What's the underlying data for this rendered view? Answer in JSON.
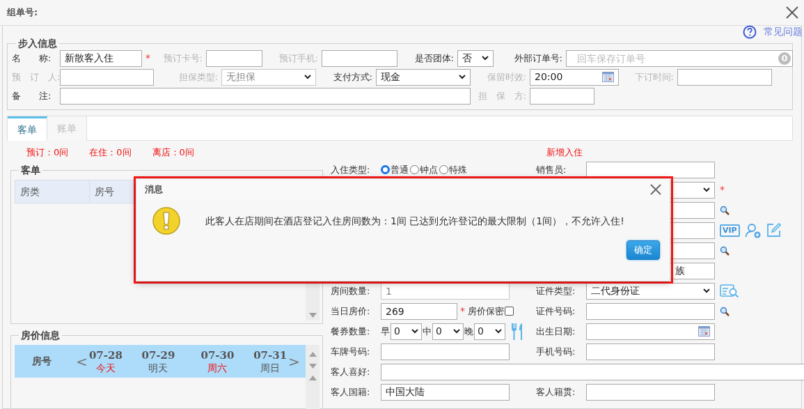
{
  "header": {
    "title": "组单号:"
  },
  "help_link": {
    "label": "常见问题"
  },
  "required_mark": "*",
  "booking": {
    "legend": "步入信息",
    "lines": [
      {
        "fields": [
          {
            "label": "名　　称:",
            "kind": "text",
            "value": "新散客入住",
            "required": true,
            "muted": false,
            "disabled": false
          },
          {
            "label": "预订卡号:",
            "kind": "text",
            "required": false,
            "muted": true,
            "disabled": false
          },
          {
            "label": "预订手机:",
            "kind": "text",
            "required": false,
            "muted": true,
            "disabled": false
          },
          {
            "label": "是否团体:",
            "kind": "select",
            "value": "否",
            "required": false,
            "muted": false,
            "disabled": false
          },
          {
            "label": "外部订单号:",
            "kind": "text",
            "placeholder": "回车保存订单号",
            "badge": "0",
            "required": false,
            "muted": false,
            "disabled": false
          }
        ]
      },
      {
        "fields": [
          {
            "label": "预　订　人:",
            "kind": "text",
            "required": false,
            "muted": true,
            "disabled": false
          },
          {
            "label": "担保类型:",
            "kind": "select",
            "value": "无担保",
            "required": false,
            "muted": true,
            "disabled": true
          },
          {
            "label": "支付方式:",
            "kind": "select",
            "value": "现金",
            "required": false,
            "muted": false,
            "disabled": false
          },
          {
            "label": "保留时效:",
            "kind": "date",
            "value": "20:00",
            "required": false,
            "muted": true,
            "disabled": false
          },
          {
            "label": "下订时间:",
            "kind": "text",
            "required": false,
            "muted": true,
            "disabled": false
          }
        ]
      },
      {
        "fields": [
          {
            "label": "备　　注:",
            "kind": "text",
            "required": false,
            "muted": false,
            "disabled": false
          },
          {
            "label": "担　保　方:",
            "kind": "text",
            "required": false,
            "muted": true,
            "disabled": false
          }
        ]
      }
    ]
  },
  "tabs": [
    {
      "label": "客单",
      "selected": true
    },
    {
      "label": "账单",
      "selected": false
    }
  ],
  "counts": [
    "预订：0间",
    "在住：0间",
    "离店：0间"
  ],
  "new_checkin": "新增入住",
  "guest_list": {
    "legend": "客单",
    "columns": [
      "房类",
      "房号"
    ]
  },
  "rates": {
    "legend": "房价信息",
    "room_header": "房号",
    "prev": "<",
    "next": ">",
    "days": [
      {
        "date": "07-28",
        "day": "今天",
        "highlight": true
      },
      {
        "date": "07-29",
        "day": "明天",
        "highlight": false
      },
      {
        "date": "07-30",
        "day": "周六",
        "highlight": true
      },
      {
        "date": "07-31",
        "day": "周日",
        "highlight": false
      }
    ]
  },
  "guest_form": {
    "rows": [
      {
        "left": {
          "label": "入住类型:",
          "kind": "radio",
          "options": [
            {
              "label": "普通",
              "selected": true
            },
            {
              "label": "钟点",
              "selected": false
            },
            {
              "label": "特殊",
              "selected": false
            }
          ]
        },
        "right": {
          "label": "销售员:",
          "kind": "text"
        }
      },
      {
        "right": {
          "kind": "select",
          "required": true
        }
      },
      {
        "right": {
          "kind": "text"
        }
      },
      {
        "right": {
          "kind": "text",
          "tag": "VIP"
        }
      },
      {
        "right": {
          "kind": "text"
        }
      },
      {
        "right": {
          "kind": "text",
          "value": "族"
        }
      },
      {
        "left": {
          "label": "房间数量:",
          "kind": "text",
          "value": "1",
          "disabled": true
        },
        "right": {
          "label": "证件类型:",
          "kind": "select",
          "value": "二代身份证"
        }
      },
      {
        "left": {
          "label": "当日房价:",
          "kind": "price",
          "value": "269",
          "required": true,
          "secret_label": "房价保密",
          "secret": false
        },
        "right": {
          "label": "证件号码:",
          "kind": "text"
        }
      },
      {
        "left": {
          "label": "餐券数量:",
          "kind": "meal",
          "meals": [
            {
              "label": "早",
              "value": "0"
            },
            {
              "label": "中",
              "value": "0"
            },
            {
              "label": "晚",
              "value": "0"
            }
          ]
        },
        "right": {
          "label": "出生日期:",
          "kind": "date"
        }
      },
      {
        "left": {
          "label": "车牌号码:",
          "kind": "text"
        },
        "right": {
          "label": "手机号码:",
          "kind": "text"
        }
      },
      {
        "left": {
          "label": "客人喜好:",
          "kind": "wide"
        }
      },
      {
        "left": {
          "label": "客人国籍:",
          "kind": "text",
          "value": "中国大陆"
        },
        "right": {
          "label": "客人籍贯:",
          "kind": "text"
        }
      }
    ]
  },
  "dialog": {
    "title": "消息",
    "message": "此客人在店期间在酒店登记入住房间数为：1间 已达到允许登记的最大限制（1间），不允许入住!",
    "button": "确定",
    "highlighted": true
  }
}
